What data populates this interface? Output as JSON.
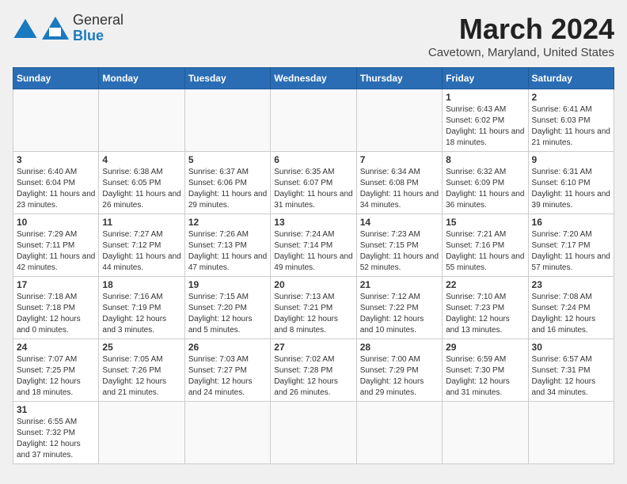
{
  "header": {
    "logo_general": "General",
    "logo_blue": "Blue",
    "month_title": "March 2024",
    "location": "Cavetown, Maryland, United States"
  },
  "days_of_week": [
    "Sunday",
    "Monday",
    "Tuesday",
    "Wednesday",
    "Thursday",
    "Friday",
    "Saturday"
  ],
  "weeks": [
    [
      {
        "day": "",
        "info": ""
      },
      {
        "day": "",
        "info": ""
      },
      {
        "day": "",
        "info": ""
      },
      {
        "day": "",
        "info": ""
      },
      {
        "day": "",
        "info": ""
      },
      {
        "day": "1",
        "info": "Sunrise: 6:43 AM\nSunset: 6:02 PM\nDaylight: 11 hours and 18 minutes."
      },
      {
        "day": "2",
        "info": "Sunrise: 6:41 AM\nSunset: 6:03 PM\nDaylight: 11 hours and 21 minutes."
      }
    ],
    [
      {
        "day": "3",
        "info": "Sunrise: 6:40 AM\nSunset: 6:04 PM\nDaylight: 11 hours and 23 minutes."
      },
      {
        "day": "4",
        "info": "Sunrise: 6:38 AM\nSunset: 6:05 PM\nDaylight: 11 hours and 26 minutes."
      },
      {
        "day": "5",
        "info": "Sunrise: 6:37 AM\nSunset: 6:06 PM\nDaylight: 11 hours and 29 minutes."
      },
      {
        "day": "6",
        "info": "Sunrise: 6:35 AM\nSunset: 6:07 PM\nDaylight: 11 hours and 31 minutes."
      },
      {
        "day": "7",
        "info": "Sunrise: 6:34 AM\nSunset: 6:08 PM\nDaylight: 11 hours and 34 minutes."
      },
      {
        "day": "8",
        "info": "Sunrise: 6:32 AM\nSunset: 6:09 PM\nDaylight: 11 hours and 36 minutes."
      },
      {
        "day": "9",
        "info": "Sunrise: 6:31 AM\nSunset: 6:10 PM\nDaylight: 11 hours and 39 minutes."
      }
    ],
    [
      {
        "day": "10",
        "info": "Sunrise: 7:29 AM\nSunset: 7:11 PM\nDaylight: 11 hours and 42 minutes."
      },
      {
        "day": "11",
        "info": "Sunrise: 7:27 AM\nSunset: 7:12 PM\nDaylight: 11 hours and 44 minutes."
      },
      {
        "day": "12",
        "info": "Sunrise: 7:26 AM\nSunset: 7:13 PM\nDaylight: 11 hours and 47 minutes."
      },
      {
        "day": "13",
        "info": "Sunrise: 7:24 AM\nSunset: 7:14 PM\nDaylight: 11 hours and 49 minutes."
      },
      {
        "day": "14",
        "info": "Sunrise: 7:23 AM\nSunset: 7:15 PM\nDaylight: 11 hours and 52 minutes."
      },
      {
        "day": "15",
        "info": "Sunrise: 7:21 AM\nSunset: 7:16 PM\nDaylight: 11 hours and 55 minutes."
      },
      {
        "day": "16",
        "info": "Sunrise: 7:20 AM\nSunset: 7:17 PM\nDaylight: 11 hours and 57 minutes."
      }
    ],
    [
      {
        "day": "17",
        "info": "Sunrise: 7:18 AM\nSunset: 7:18 PM\nDaylight: 12 hours and 0 minutes."
      },
      {
        "day": "18",
        "info": "Sunrise: 7:16 AM\nSunset: 7:19 PM\nDaylight: 12 hours and 3 minutes."
      },
      {
        "day": "19",
        "info": "Sunrise: 7:15 AM\nSunset: 7:20 PM\nDaylight: 12 hours and 5 minutes."
      },
      {
        "day": "20",
        "info": "Sunrise: 7:13 AM\nSunset: 7:21 PM\nDaylight: 12 hours and 8 minutes."
      },
      {
        "day": "21",
        "info": "Sunrise: 7:12 AM\nSunset: 7:22 PM\nDaylight: 12 hours and 10 minutes."
      },
      {
        "day": "22",
        "info": "Sunrise: 7:10 AM\nSunset: 7:23 PM\nDaylight: 12 hours and 13 minutes."
      },
      {
        "day": "23",
        "info": "Sunrise: 7:08 AM\nSunset: 7:24 PM\nDaylight: 12 hours and 16 minutes."
      }
    ],
    [
      {
        "day": "24",
        "info": "Sunrise: 7:07 AM\nSunset: 7:25 PM\nDaylight: 12 hours and 18 minutes."
      },
      {
        "day": "25",
        "info": "Sunrise: 7:05 AM\nSunset: 7:26 PM\nDaylight: 12 hours and 21 minutes."
      },
      {
        "day": "26",
        "info": "Sunrise: 7:03 AM\nSunset: 7:27 PM\nDaylight: 12 hours and 24 minutes."
      },
      {
        "day": "27",
        "info": "Sunrise: 7:02 AM\nSunset: 7:28 PM\nDaylight: 12 hours and 26 minutes."
      },
      {
        "day": "28",
        "info": "Sunrise: 7:00 AM\nSunset: 7:29 PM\nDaylight: 12 hours and 29 minutes."
      },
      {
        "day": "29",
        "info": "Sunrise: 6:59 AM\nSunset: 7:30 PM\nDaylight: 12 hours and 31 minutes."
      },
      {
        "day": "30",
        "info": "Sunrise: 6:57 AM\nSunset: 7:31 PM\nDaylight: 12 hours and 34 minutes."
      }
    ],
    [
      {
        "day": "31",
        "info": "Sunrise: 6:55 AM\nSunset: 7:32 PM\nDaylight: 12 hours and 37 minutes."
      },
      {
        "day": "",
        "info": ""
      },
      {
        "day": "",
        "info": ""
      },
      {
        "day": "",
        "info": ""
      },
      {
        "day": "",
        "info": ""
      },
      {
        "day": "",
        "info": ""
      },
      {
        "day": "",
        "info": ""
      }
    ]
  ]
}
